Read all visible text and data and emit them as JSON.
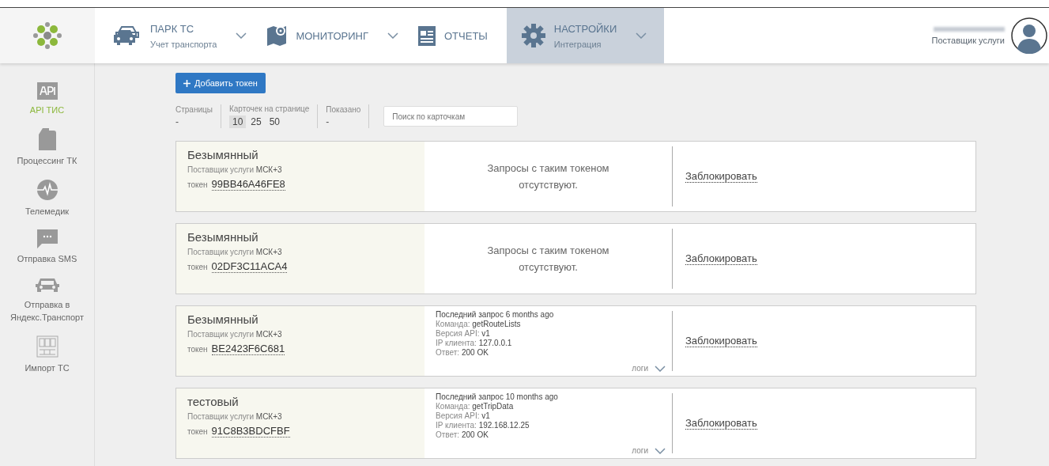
{
  "nav": [
    {
      "kind": "cars",
      "title": "ПАРК ТС",
      "subtitle": "Учет транспорта",
      "dropdown": true,
      "selected": false
    },
    {
      "kind": "map",
      "title": "МОНИТОРИНГ",
      "dropdown": true,
      "selected": false
    },
    {
      "kind": "report",
      "title": "ОТЧЕТЫ",
      "dropdown": false,
      "selected": false
    },
    {
      "kind": "gear",
      "title": "НАСТРОЙКИ",
      "subtitle": "Интеграция",
      "dropdown": true,
      "selected": true
    }
  ],
  "user": {
    "role": "Поставщик услуги"
  },
  "sidebar": {
    "items": [
      {
        "kind": "api",
        "label": "API ТИС",
        "selected": true
      },
      {
        "kind": "canister",
        "label": "Процессинг ТК",
        "selected": false
      },
      {
        "kind": "pulse",
        "label": "Телемедик",
        "selected": false
      },
      {
        "kind": "chat",
        "label": "Отправка SMS",
        "selected": false
      },
      {
        "kind": "car",
        "label": "Отправка в Яндекс.Транспорт",
        "selected": false
      },
      {
        "kind": "grid",
        "label": "Импорт ТС",
        "selected": false
      }
    ]
  },
  "add_button": "Добавить токен",
  "filters": {
    "pages": {
      "label": "Страницы",
      "value": "-"
    },
    "per_page": {
      "label": "Карточек на странице",
      "options": [
        {
          "label": "10",
          "selected": true
        },
        {
          "label": "25",
          "selected": false
        },
        {
          "label": "50",
          "selected": false
        }
      ]
    },
    "shown": {
      "label": "Показано",
      "value": "-"
    },
    "search": {
      "placeholder": "Поиск по карточкам"
    }
  },
  "cards": [
    {
      "name": "Безымянный",
      "provider": "Поставщик услуги **МСК+3**",
      "token_label": "токен",
      "token": "99BB46A46FE8",
      "requests": {
        "kind": "empty",
        "message": "Запросы с таким токеном отсутствуют."
      },
      "action": "Заблокировать"
    },
    {
      "name": "Безымянный",
      "provider": "Поставщик услуги **МСК+3**",
      "token_label": "токен",
      "token": "02DF3C11ACA4",
      "requests": {
        "kind": "empty",
        "message": "Запросы с таким токеном отсутствуют."
      },
      "action": "Заблокировать"
    },
    {
      "name": "Безымянный",
      "provider": "Поставщик услуги **МСК+3**",
      "token_label": "токен",
      "token": "BE2423F6C681",
      "requests": {
        "kind": "log",
        "lines": [
          "Последний запрос 6 months ago",
          "Команда: **getRouteLists**",
          "Версия API: **v1**",
          "IP клиента: **127.0.0.1**",
          "Ответ: **200 OK**"
        ],
        "logs": "логи"
      },
      "action": "Заблокировать"
    },
    {
      "name": "тестовый",
      "provider": "Поставщик услуги **МСК+3**",
      "token_label": "токен",
      "token": "91C8B3BDCFBF",
      "requests": {
        "kind": "log",
        "lines": [
          "Последний запрос 10 months ago",
          "Команда: **getTripData**",
          "Версия API: **v1**",
          "IP клиента: **192.168.12.25**",
          "Ответ: **200 OK**"
        ],
        "logs": "логи"
      },
      "action": "Заблокировать"
    }
  ]
}
